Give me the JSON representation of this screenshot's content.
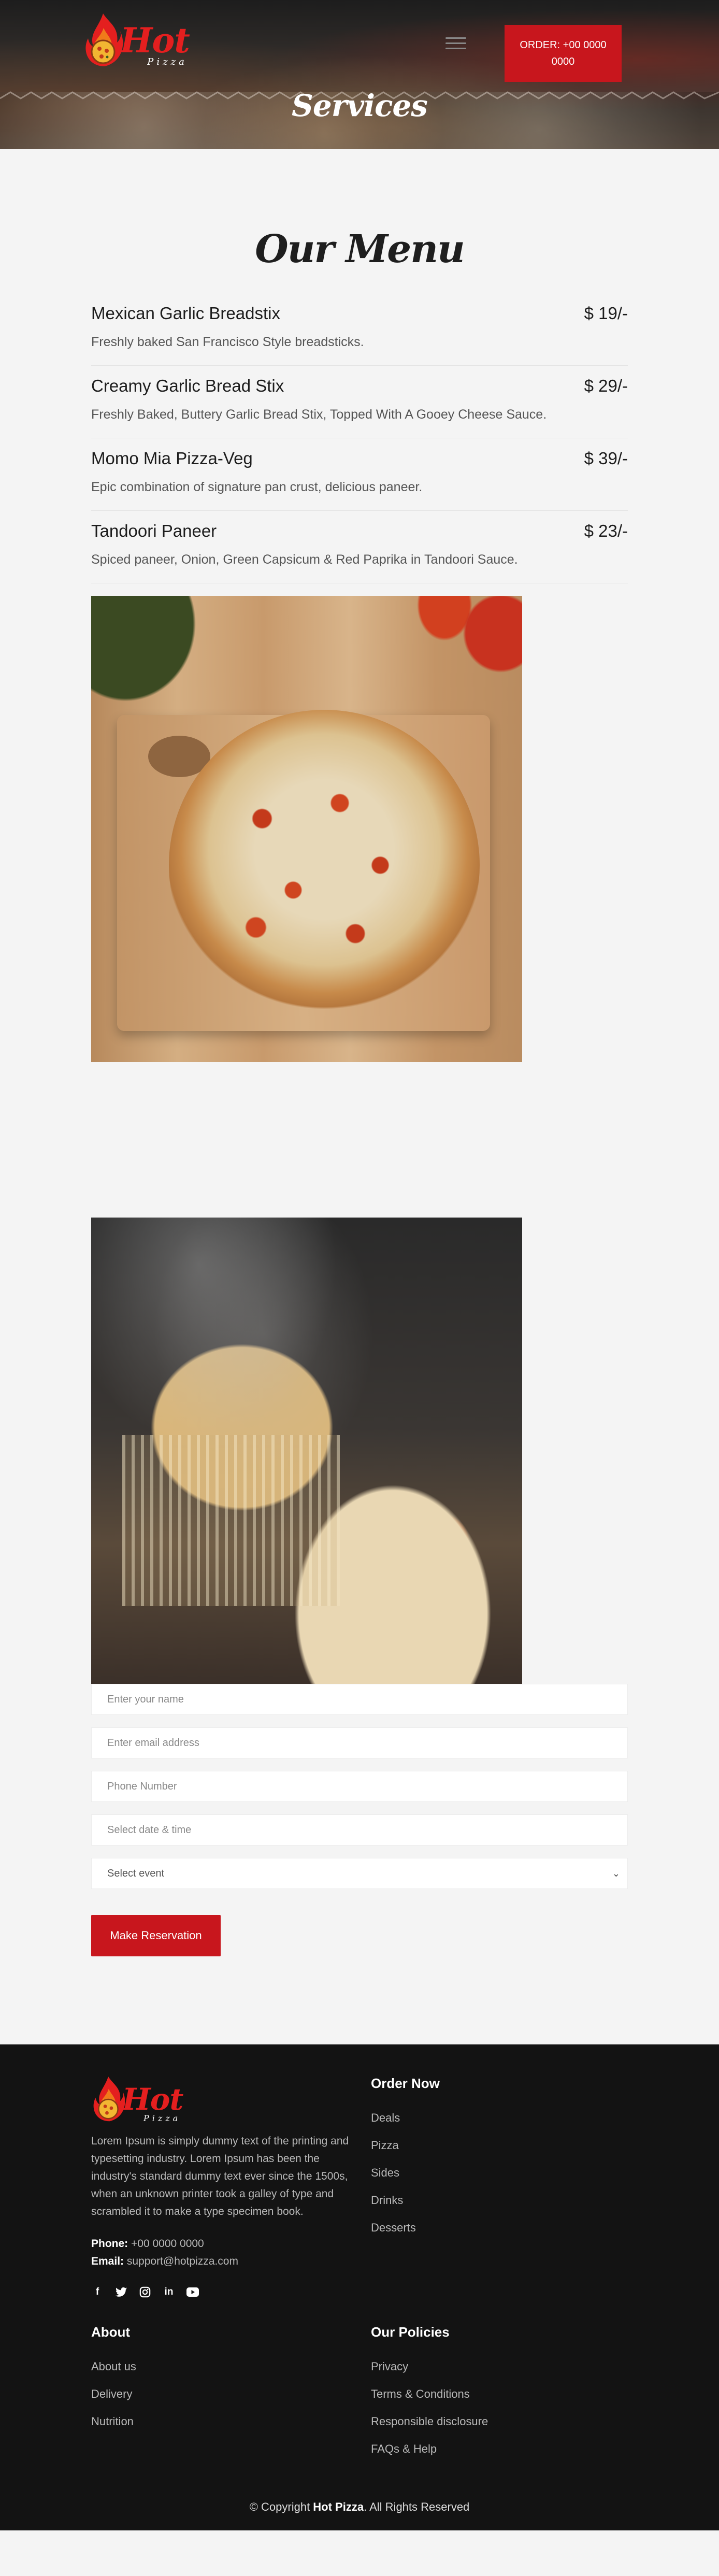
{
  "header": {
    "logo_text": "Hot",
    "logo_sub": "Pizza",
    "order_button": "ORDER: +00 0000 0000",
    "page_title": "Services"
  },
  "menu": {
    "title": "Our Menu",
    "items": [
      {
        "name": "Mexican Garlic Breadstix",
        "price": "$ 19/-",
        "desc": "Freshly baked San Francisco Style breadsticks."
      },
      {
        "name": "Creamy Garlic Bread Stix",
        "price": "$ 29/-",
        "desc": "Freshly Baked, Buttery Garlic Bread Stix, Topped With A Gooey Cheese Sauce."
      },
      {
        "name": "Momo Mia Pizza-Veg",
        "price": "$ 39/-",
        "desc": "Epic combination of signature pan crust, delicious paneer."
      },
      {
        "name": "Tandoori Paneer",
        "price": "$ 23/-",
        "desc": "Spiced paneer, Onion, Green Capsicum & Red Paprika in Tandoori Sauce."
      }
    ]
  },
  "reservation": {
    "name_placeholder": "Enter your name",
    "email_placeholder": "Enter email address",
    "phone_placeholder": "Phone Number",
    "datetime_placeholder": "Select date & time",
    "event_select": "Select event",
    "submit": "Make Reservation"
  },
  "footer": {
    "logo_text": "Hot",
    "logo_sub": "Pizza",
    "about_text": "Lorem Ipsum is simply dummy text of the printing and typesetting industry. Lorem Ipsum has been the industry's standard dummy text ever since the 1500s, when an unknown printer took a galley of type and scrambled it to make a type specimen book.",
    "phone_label": "Phone:",
    "phone_value": "+00 0000 0000",
    "email_label": "Email:",
    "email_value": "support@hotpizza.com",
    "socials": [
      "facebook-icon",
      "twitter-icon",
      "instagram-icon",
      "linkedin-icon",
      "youtube-icon"
    ],
    "order_now": {
      "title": "Order Now",
      "links": [
        "Deals",
        "Pizza",
        "Sides",
        "Drinks",
        "Desserts"
      ]
    },
    "about": {
      "title": "About",
      "links": [
        "About us",
        "Delivery",
        "Nutrition"
      ]
    },
    "policies": {
      "title": "Our Policies",
      "links": [
        "Privacy",
        "Terms & Conditions",
        "Responsible disclosure",
        "FAQs & Help"
      ]
    },
    "copyright_pre": "© Copyright ",
    "copyright_brand": "Hot Pizza",
    "copyright_post": ". All Rights Reserved"
  },
  "colors": {
    "accent": "#c8161d",
    "footer_bg": "#131313",
    "page_bg": "#f4f4f4"
  }
}
